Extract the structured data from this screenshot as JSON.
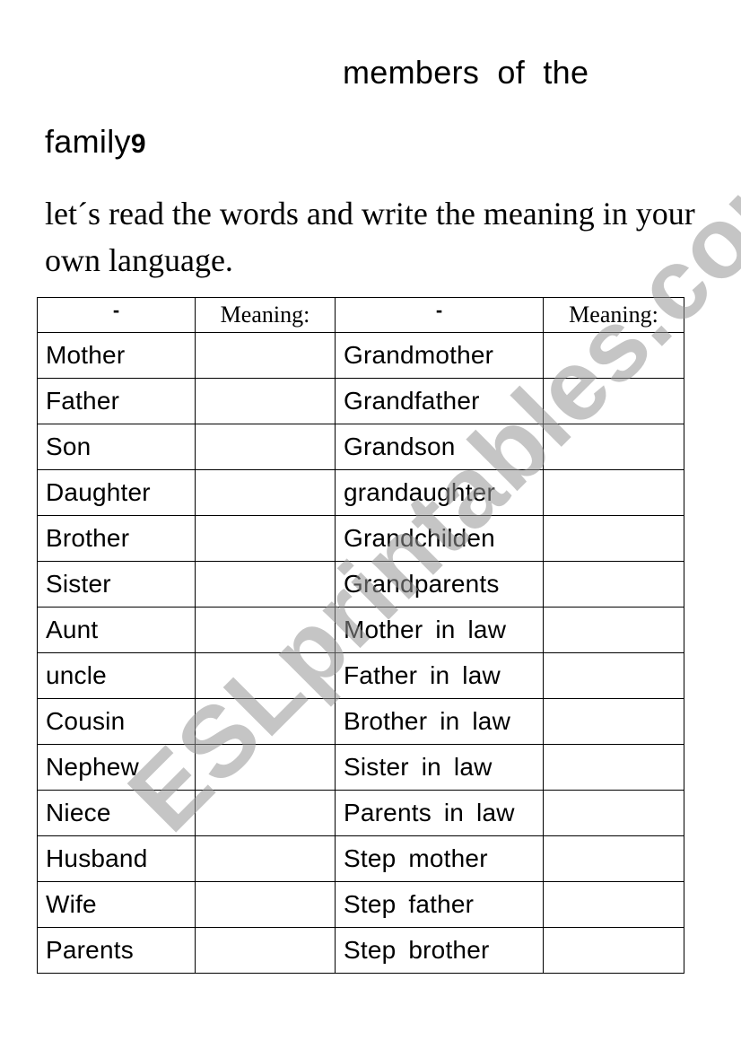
{
  "worksheet": {
    "title_line1": "members of the",
    "title_line2": "family",
    "title_glyph": "9",
    "instructions": "let´s read the words and write the meaning in your own language.",
    "watermark": "ESLprintables.com"
  },
  "table": {
    "headers": [
      "-",
      "Meaning:",
      "-",
      "Meaning:"
    ],
    "rows": [
      {
        "word1": "Mother",
        "meaning1": "",
        "word2": "Grandmother",
        "meaning2": ""
      },
      {
        "word1": "Father",
        "meaning1": "",
        "word2": "Grandfather",
        "meaning2": ""
      },
      {
        "word1": "Son",
        "meaning1": "",
        "word2": "Grandson",
        "meaning2": ""
      },
      {
        "word1": "Daughter",
        "meaning1": "",
        "word2": "grandaughter",
        "meaning2": ""
      },
      {
        "word1": "Brother",
        "meaning1": "",
        "word2": "Grandchilden",
        "meaning2": ""
      },
      {
        "word1": "Sister",
        "meaning1": "",
        "word2": "Grandparents",
        "meaning2": ""
      },
      {
        "word1": "Aunt",
        "meaning1": "",
        "word2": "Mother in law",
        "meaning2": ""
      },
      {
        "word1": "uncle",
        "meaning1": "",
        "word2": "Father in law",
        "meaning2": ""
      },
      {
        "word1": "Cousin",
        "meaning1": "",
        "word2": "Brother in law",
        "meaning2": ""
      },
      {
        "word1": "Nephew",
        "meaning1": "",
        "word2": "Sister in law",
        "meaning2": ""
      },
      {
        "word1": "Niece",
        "meaning1": "",
        "word2": "Parents in law",
        "meaning2": ""
      },
      {
        "word1": "Husband",
        "meaning1": "",
        "word2": "Step mother",
        "meaning2": ""
      },
      {
        "word1": "Wife",
        "meaning1": "",
        "word2": "Step father",
        "meaning2": ""
      },
      {
        "word1": "Parents",
        "meaning1": "",
        "word2": "Step brother",
        "meaning2": ""
      }
    ]
  }
}
